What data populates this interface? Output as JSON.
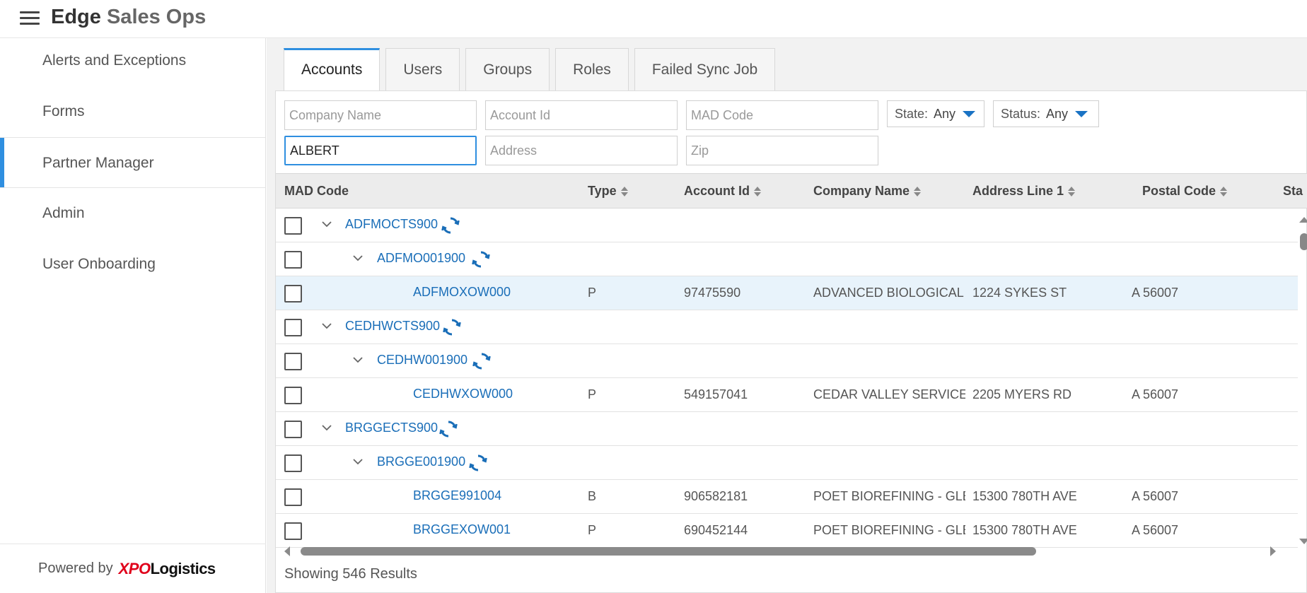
{
  "app": {
    "title_main": "Edge",
    "title_rest": "Sales Ops"
  },
  "sidebar": {
    "items": [
      {
        "label": "Alerts and Exceptions"
      },
      {
        "label": "Forms"
      },
      {
        "label": "Partner Manager"
      },
      {
        "label": "Admin"
      },
      {
        "label": "User Onboarding"
      }
    ],
    "powered_by": "Powered by",
    "logo_xpo": "XPO",
    "logo_rest": "Logistics"
  },
  "tabs": [
    "Accounts",
    "Users",
    "Groups",
    "Roles",
    "Failed Sync Job"
  ],
  "filters": {
    "company_name_ph": "Company Name",
    "account_id_ph": "Account Id",
    "mad_code_ph": "MAD Code",
    "name_value": "ALBERT",
    "address_ph": "Address",
    "zip_ph": "Zip",
    "state_label": "State:",
    "state_value": "Any",
    "status_label": "Status:",
    "status_value": "Any"
  },
  "table": {
    "headers": {
      "mad_code": "MAD Code",
      "type": "Type",
      "account_id": "Account Id",
      "company_name": "Company Name",
      "address": "Address Line 1",
      "postal": "Postal Code",
      "state_partial": "Sta"
    },
    "rows": [
      {
        "code": "ADFMOCTS900",
        "type": "",
        "account_id": "",
        "company": "",
        "address": "",
        "postal": ""
      },
      {
        "code": "ADFMO001900",
        "type": "",
        "account_id": "",
        "company": "",
        "address": "",
        "postal": ""
      },
      {
        "code": "ADFMOXOW000",
        "type": "P",
        "account_id": "97475590",
        "company": "ADVANCED BIOLOGICAL M",
        "address": "1224 SYKES ST",
        "postal": "A 56007"
      },
      {
        "code": "CEDHWCTS900",
        "type": "",
        "account_id": "",
        "company": "",
        "address": "",
        "postal": ""
      },
      {
        "code": "CEDHW001900",
        "type": "",
        "account_id": "",
        "company": "",
        "address": "",
        "postal": ""
      },
      {
        "code": "CEDHWXOW000",
        "type": "P",
        "account_id": "549157041",
        "company": "CEDAR VALLEY SERVICES",
        "address": "2205 MYERS RD",
        "postal": "A 56007"
      },
      {
        "code": "BRGGECTS900",
        "type": "",
        "account_id": "",
        "company": "",
        "address": "",
        "postal": ""
      },
      {
        "code": "BRGGE001900",
        "type": "",
        "account_id": "",
        "company": "",
        "address": "",
        "postal": ""
      },
      {
        "code": "BRGGE991004",
        "type": "B",
        "account_id": "906582181",
        "company": "POET BIOREFINING - GLEN",
        "address": "15300 780TH AVE",
        "postal": "A 56007"
      },
      {
        "code": "BRGGEXOW001",
        "type": "P",
        "account_id": "690452144",
        "company": "POET BIOREFINING - GLEN",
        "address": "15300 780TH AVE",
        "postal": "A 56007"
      }
    ]
  },
  "results_text": "Showing 546 Results",
  "colors": {
    "accent": "#2f8fe0",
    "link": "#1a6eb8",
    "highlight_row": "#e8f3fb",
    "xpo_red": "#e0001b"
  }
}
